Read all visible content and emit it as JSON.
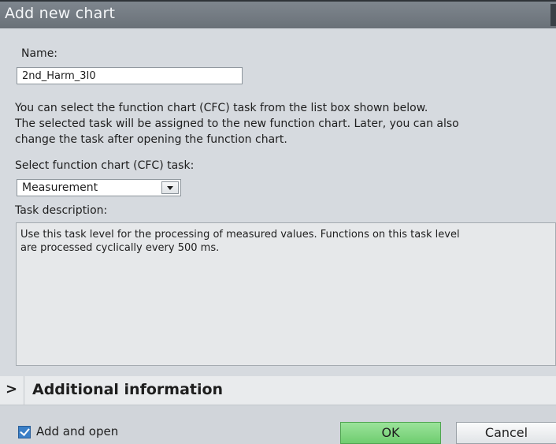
{
  "dialog": {
    "title": "Add new chart"
  },
  "name": {
    "label": "Name:",
    "value": "2nd_Harm_3I0"
  },
  "info": {
    "lines": [
      "You can select the function chart (CFC) task from the list box shown below.",
      "The selected task will be assigned to the new function chart. Later, you can also",
      "change the task after opening the function chart."
    ]
  },
  "task_select": {
    "label": "Select function chart (CFC) task:",
    "selected": "Measurement"
  },
  "task_description": {
    "label": "Task description:",
    "lines": [
      "Use this task level for the processing of measured values. Functions on this task level",
      "are processed cyclically every 500 ms."
    ]
  },
  "additional_info": {
    "chevron": ">",
    "title": "Additional information"
  },
  "footer": {
    "add_and_open_label": "Add and open",
    "add_and_open_checked": true,
    "ok_label": "OK",
    "cancel_label": "Cancel"
  },
  "colors": {
    "ok_button": "#7ed47f",
    "checkbox": "#3a7fc7",
    "titlebar": "#737b83"
  }
}
